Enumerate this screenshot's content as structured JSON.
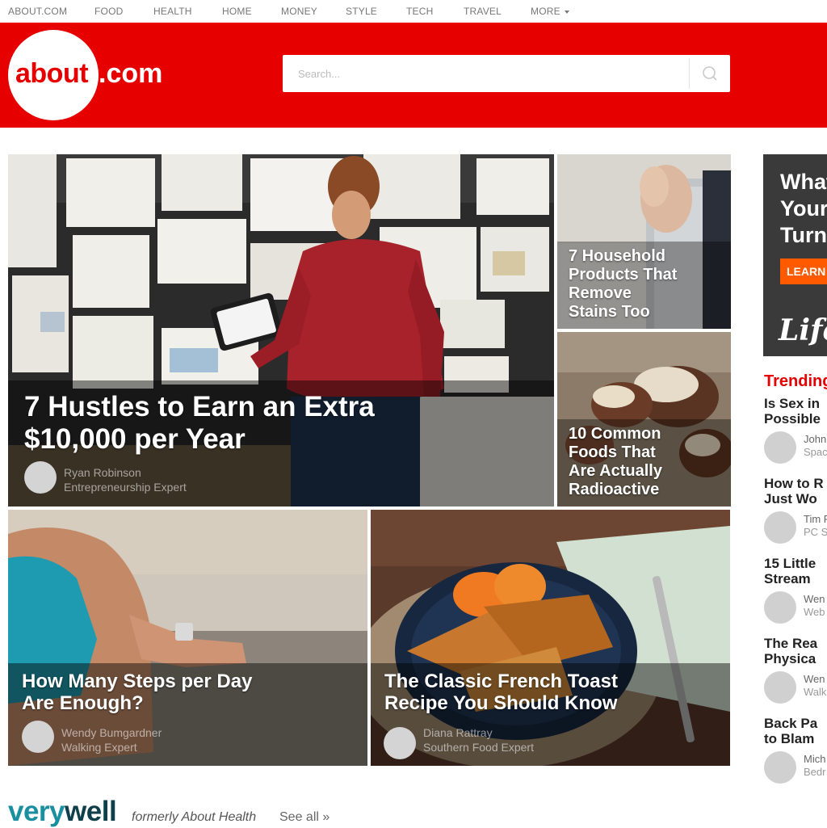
{
  "topnav": {
    "items": [
      "ABOUT.COM",
      "FOOD",
      "HEALTH",
      "HOME",
      "MONEY",
      "STYLE",
      "TECH",
      "TRAVEL",
      "MORE"
    ]
  },
  "header": {
    "logo_main": "about",
    "logo_suffix": ".com",
    "search_placeholder": "Search..."
  },
  "features": {
    "main": {
      "title_line1": "7 Hustles to Earn an Extra",
      "title_line2": "$10,000 per Year",
      "author": "Ryan Robinson",
      "role": "Entrepreneurship Expert"
    },
    "stains": {
      "lines": [
        "7 Household",
        "Products That",
        "Remove",
        "Stains Too"
      ]
    },
    "radioactive": {
      "lines": [
        "10 Common",
        "Foods That",
        "Are Actually",
        "Radioactive"
      ]
    },
    "steps": {
      "title_line1": "How Many Steps per Day",
      "title_line2": "Are Enough?",
      "author": "Wendy Bumgardner",
      "role": "Walking Expert"
    },
    "toast": {
      "title_line1": "The Classic French Toast",
      "title_line2": "Recipe You Should Know",
      "author": "Diana Rattray",
      "role": "Southern Food Expert"
    }
  },
  "ad": {
    "lines": [
      "What",
      "Your",
      "Turn"
    ],
    "button": "LEARN",
    "brand": "Life"
  },
  "trending": {
    "heading": "Trending",
    "items": [
      {
        "title1": "Is Sex in",
        "title2": "Possible",
        "author": "John",
        "role": "Space"
      },
      {
        "title1": "How to R",
        "title2": "Just Wo",
        "author": "Tim F",
        "role": "PC S"
      },
      {
        "title1": "15 Little",
        "title2": "Stream",
        "author": "Wen",
        "role": "Web"
      },
      {
        "title1": "The Rea",
        "title2": "Physica",
        "author": "Wen",
        "role": "Walk"
      },
      {
        "title1": "Back Pa",
        "title2": "to Blam",
        "author": "Mich",
        "role": "Bedr"
      }
    ]
  },
  "footer": {
    "brand_light": "very",
    "brand_dark": "well",
    "formerly": "formerly About Health",
    "see_all": "See all »"
  },
  "colors": {
    "brand_red": "#e60000",
    "ad_orange": "#ff5a00",
    "verywell_teal": "#1a8fa0"
  }
}
